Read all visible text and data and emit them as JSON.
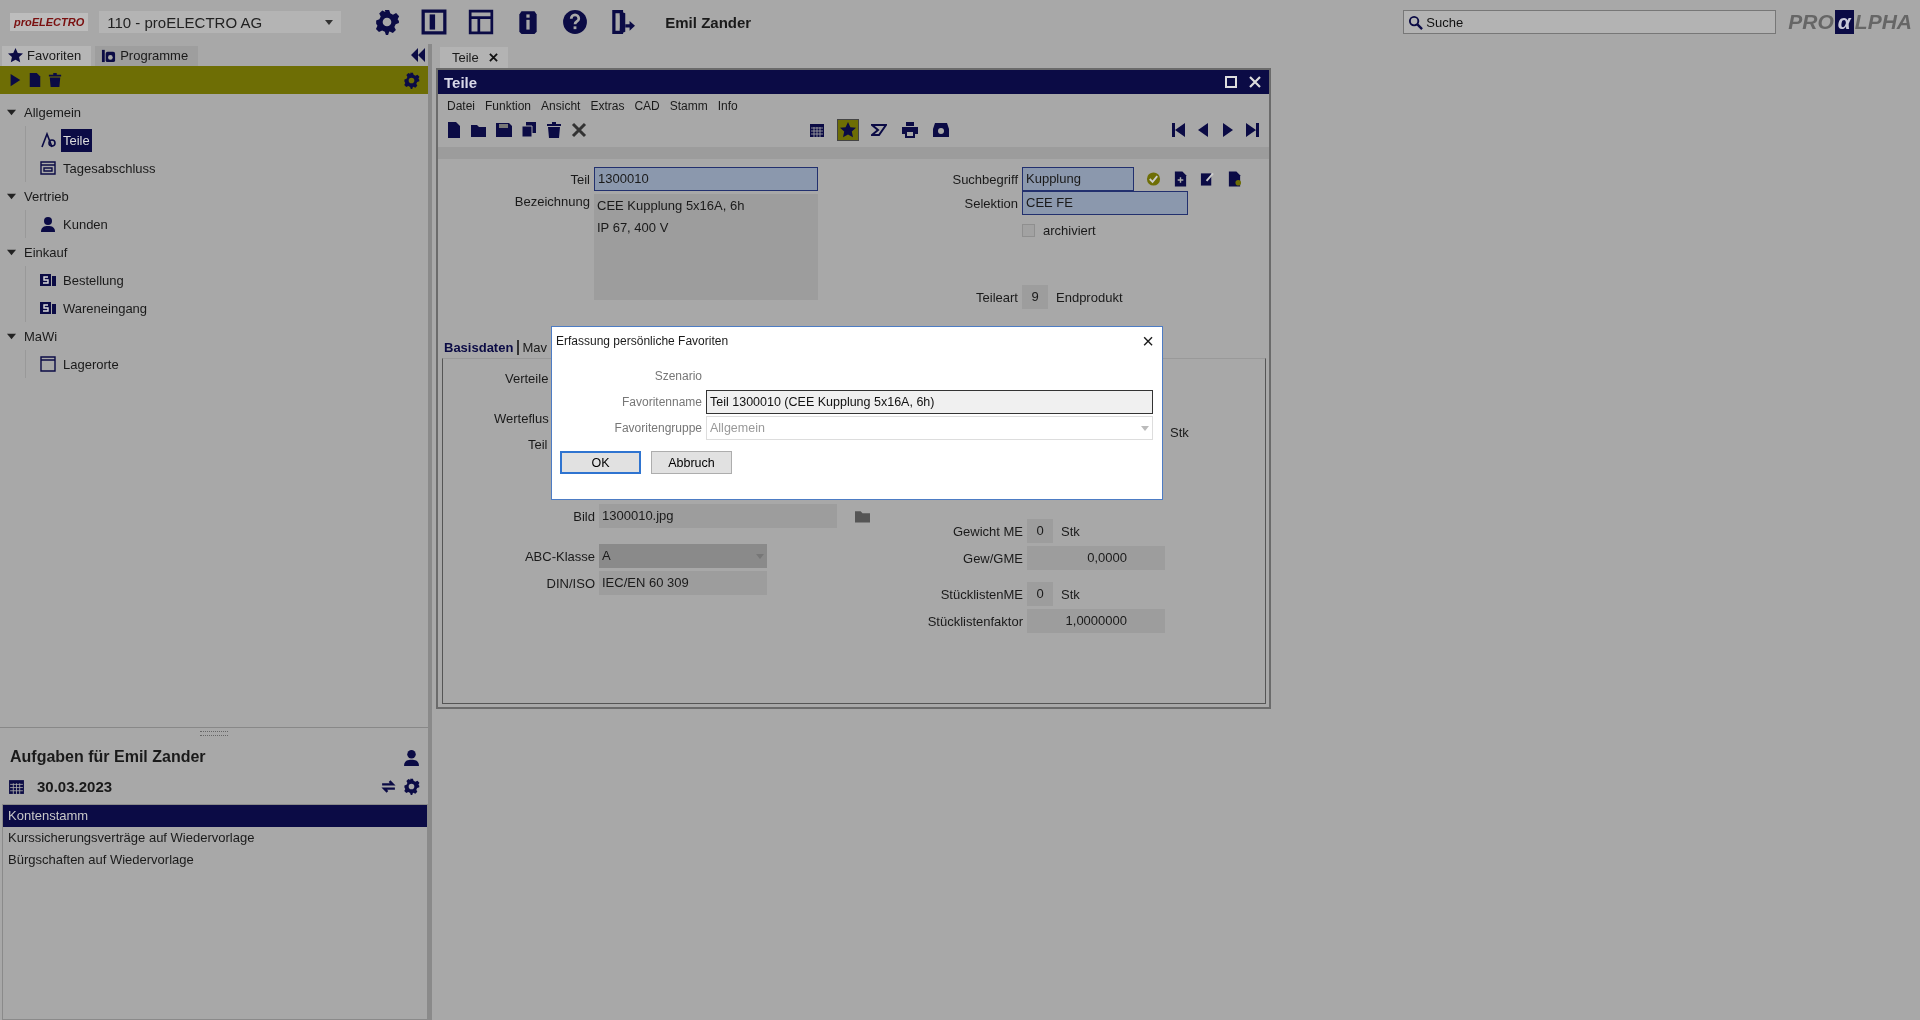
{
  "header": {
    "logo": "proELECTRO",
    "company": "110 - proELECTRO AG",
    "user": "Emil Zander",
    "search": {
      "placeholder": "Suche"
    },
    "brand": [
      "PRO",
      "α",
      "LPHA"
    ]
  },
  "left_tabs": [
    {
      "label": "Favoriten",
      "kind": "star",
      "selected": true
    },
    {
      "label": "Programme",
      "kind": "programs",
      "selected": false
    }
  ],
  "tree": [
    {
      "label": "Allgemein",
      "expanded": true,
      "children": [
        {
          "label": "Teile",
          "kind": "part",
          "selected": true
        },
        {
          "label": "Tagesabschluss",
          "kind": "report",
          "selected": false
        }
      ]
    },
    {
      "label": "Vertrieb",
      "expanded": true,
      "children": [
        {
          "label": "Kunden",
          "kind": "person",
          "selected": false
        }
      ]
    },
    {
      "label": "Einkauf",
      "expanded": true,
      "children": [
        {
          "label": "Bestellung",
          "kind": "order",
          "selected": false
        },
        {
          "label": "Wareneingang",
          "kind": "order",
          "selected": false
        }
      ]
    },
    {
      "label": "MaWi",
      "expanded": true,
      "children": [
        {
          "label": "Lagerorte",
          "kind": "window",
          "selected": false
        }
      ]
    }
  ],
  "tasks": {
    "title": "Aufgaben für Emil Zander",
    "date": "30.03.2023",
    "items": [
      {
        "label": "Kontenstamm",
        "selected": true
      },
      {
        "label": "Kurssicherungsverträge auf Wiedervorlage",
        "selected": false
      },
      {
        "label": "Bürgschaften auf Wiedervorlage",
        "selected": false
      }
    ]
  },
  "doc_tabs": [
    {
      "label": "Teile",
      "selected": true
    }
  ],
  "window": {
    "title": "Teile",
    "menu": [
      "Datei",
      "Funktion",
      "Ansicht",
      "Extras",
      "CAD",
      "Stamm",
      "Info"
    ],
    "toolbar_middle": [
      {
        "kind": "calendar",
        "active": false
      },
      {
        "kind": "star",
        "active": true
      },
      {
        "kind": "send",
        "active": false
      },
      {
        "kind": "print",
        "active": false
      },
      {
        "kind": "inbox",
        "active": false
      }
    ],
    "teil": {
      "label": "Teil",
      "value": "1300010",
      "highlighted": true
    },
    "bezeichnung": {
      "label": "Bezeichnung",
      "lines": [
        "CEE Kupplung 5x16A, 6h",
        "IP 67, 400 V"
      ]
    },
    "suchbegriff": {
      "label": "Suchbegriff",
      "value": "Kupplung",
      "highlighted": true
    },
    "selektion": {
      "label": "Selektion",
      "value": "CEE FE",
      "highlighted": true
    },
    "archiviert": {
      "label": "archiviert",
      "checked": false
    },
    "teileart": {
      "label": "Teileart",
      "code": "9",
      "text": "Endprodukt"
    },
    "detail_tabs": [
      {
        "label": "Basisdaten",
        "selected": true
      },
      {
        "label": "Mav",
        "selected": false
      }
    ],
    "cut_labels": [
      "Verteile",
      "Werteflus",
      "Teil"
    ],
    "unit": "Stk",
    "bild": {
      "label": "Bild",
      "value": "1300010.jpg"
    },
    "abc": {
      "label": "ABC-Klasse",
      "value": "A"
    },
    "din": {
      "label": "DIN/ISO",
      "value": "IEC/EN 60 309"
    },
    "gewicht_me": {
      "label": "Gewicht ME",
      "code": "0",
      "unit": "Stk"
    },
    "gew_gme": {
      "label": "Gew/GME",
      "value": "0,0000"
    },
    "stueckliste_me": {
      "label": "StücklistenME",
      "code": "0",
      "unit": "Stk"
    },
    "stueckliste_faktor": {
      "label": "Stücklistenfaktor",
      "value": "1,0000000"
    }
  },
  "dialog": {
    "title": "Erfassung persönliche Favoriten",
    "close": "×",
    "scenario_label": "Szenario",
    "name": {
      "label": "Favoritenname",
      "value": "Teil 1300010 (CEE Kupplung 5x16A, 6h)"
    },
    "group": {
      "label": "Favoritengruppe",
      "value": "Allgemein",
      "disabled": true
    },
    "buttons": [
      {
        "label": "OK",
        "selected": true
      },
      {
        "label": "Abbruch",
        "selected": false
      }
    ]
  }
}
